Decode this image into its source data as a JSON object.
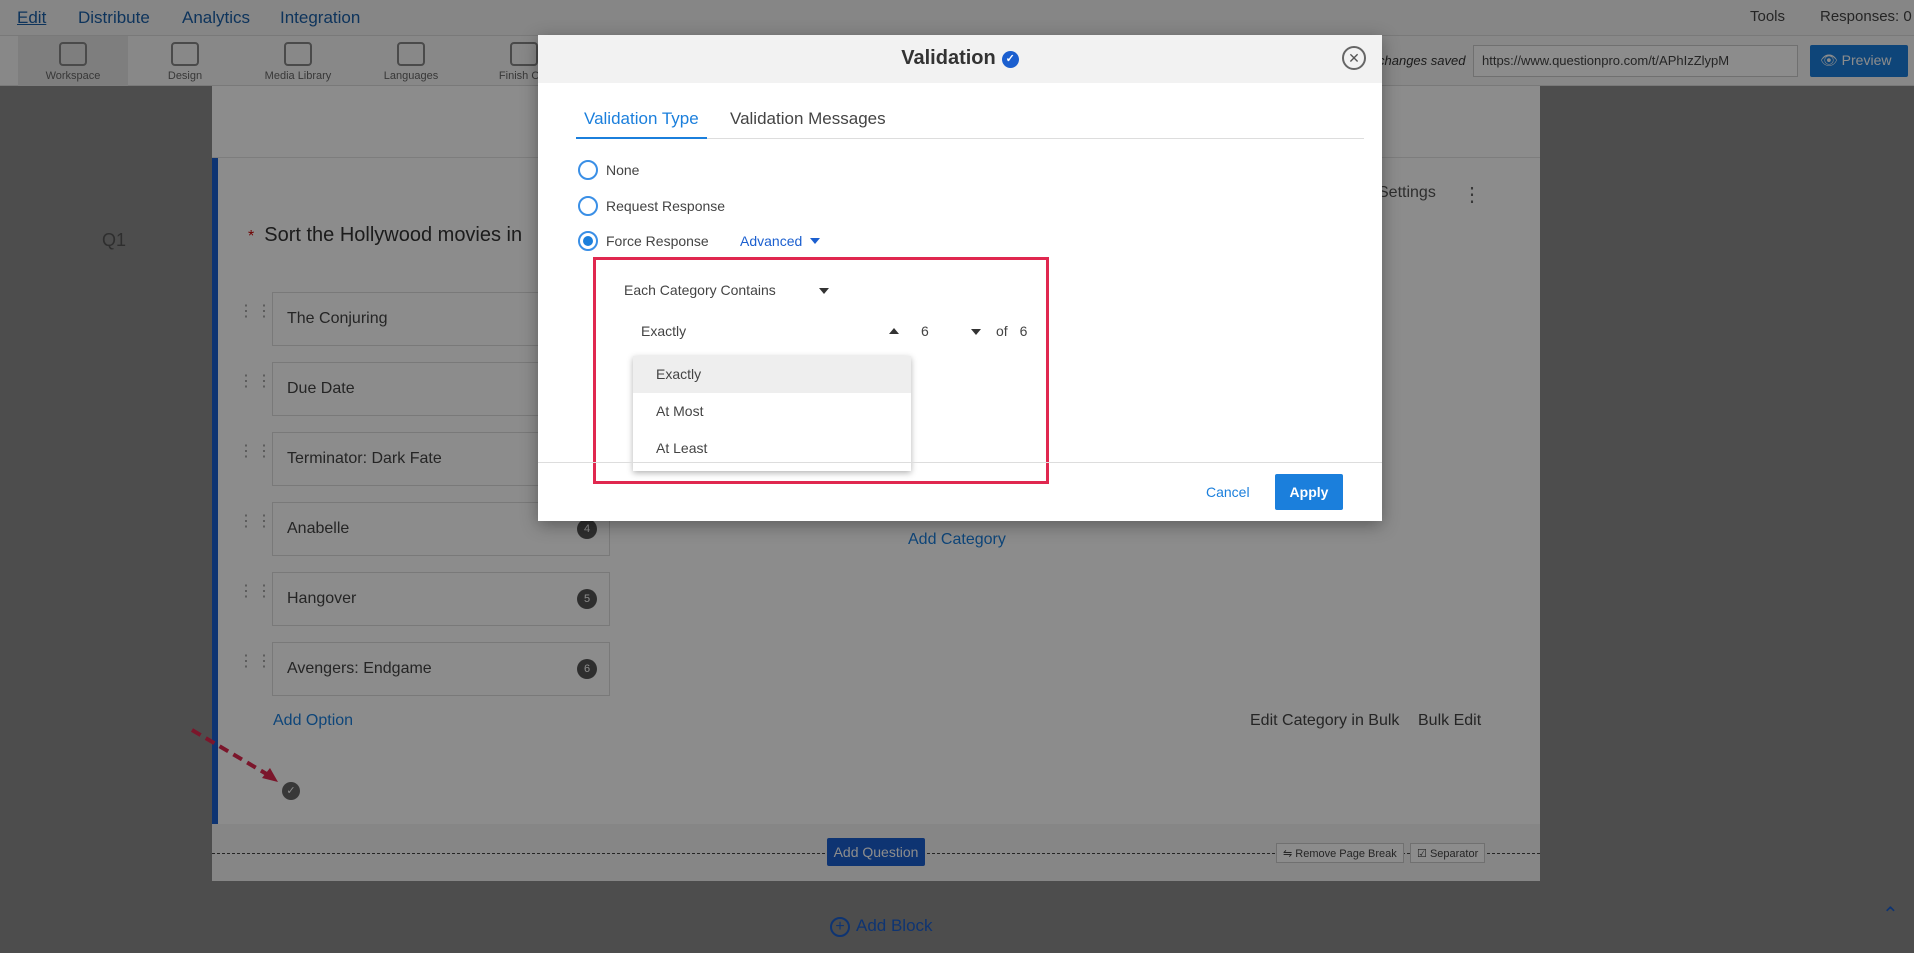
{
  "topnav": {
    "items": [
      "Edit",
      "Distribute",
      "Analytics",
      "Integration"
    ],
    "tools": "Tools",
    "responses": "Responses: 0"
  },
  "toolbar": {
    "items": [
      "Workspace",
      "Design",
      "Media Library",
      "Languages",
      "Finish Opt"
    ],
    "saved": "changes saved",
    "url": "https://www.questionpro.com/t/APhIzZlypM",
    "preview": "Preview"
  },
  "question": {
    "number": "Q1",
    "title": "Sort the Hollywood movies in",
    "settings": "Settings",
    "options": [
      {
        "label": "The Conjuring",
        "badge": ""
      },
      {
        "label": "Due Date",
        "badge": ""
      },
      {
        "label": "Terminator: Dark Fate",
        "badge": ""
      },
      {
        "label": "Anabelle",
        "badge": "4"
      },
      {
        "label": "Hangover",
        "badge": "5"
      },
      {
        "label": "Avengers: Endgame",
        "badge": "6"
      }
    ],
    "add_option": "Add Option",
    "add_category": "Add Category",
    "edit_category_bulk": "Edit Category in Bulk",
    "bulk_edit": "Bulk Edit"
  },
  "page": {
    "add_question": "Add Question",
    "remove_page_break": "Remove Page Break",
    "separator": "Separator",
    "add_block": "Add Block"
  },
  "modal": {
    "title": "Validation",
    "tabs": [
      "Validation Type",
      "Validation Messages"
    ],
    "radios": [
      "None",
      "Request Response",
      "Force Response"
    ],
    "selected_radio": "Force Response",
    "advanced": "Advanced",
    "category_select": "Each Category Contains",
    "operator_select": "Exactly",
    "count_select": "6",
    "of_label": "of",
    "of_total": "6",
    "dropdown_options": [
      "Exactly",
      "At Most",
      "At Least"
    ],
    "cancel": "Cancel",
    "apply": "Apply"
  },
  "colors": {
    "accent": "#1b7fdc",
    "brand": "#1b5fcf",
    "highlight": "#e0284f"
  }
}
